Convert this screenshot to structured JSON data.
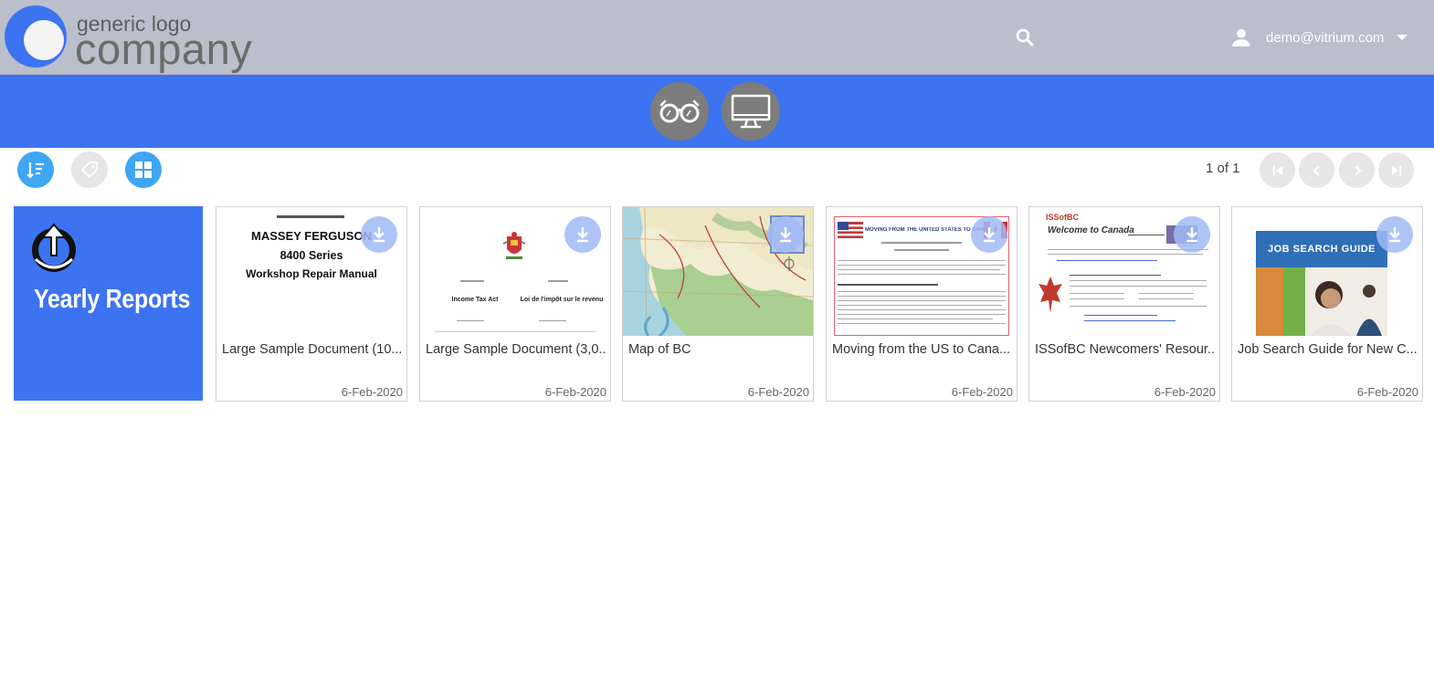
{
  "header": {
    "logo_small": "generic logo",
    "logo_big": "company",
    "user_email": "demo@vitrium.com",
    "icons": {
      "search": "search-icon",
      "user": "person-icon",
      "menu": "caret-down-icon"
    }
  },
  "band": {
    "buttons": [
      {
        "name": "reader-view",
        "icon": "glasses-icon"
      },
      {
        "name": "screen-view",
        "icon": "monitor-icon"
      }
    ]
  },
  "toolbar": {
    "buttons": [
      {
        "name": "sort",
        "icon": "sort-icon",
        "state": "active"
      },
      {
        "name": "tags",
        "icon": "tag-icon",
        "state": "disabled"
      },
      {
        "name": "grid-view",
        "icon": "grid-icon",
        "state": "active"
      }
    ],
    "page_info": "1 of 1",
    "pager": [
      "first-page-icon",
      "previous-page-icon",
      "next-page-icon",
      "last-page-icon"
    ]
  },
  "folder": {
    "title": "Yearly Reports",
    "color": "#3c73f0"
  },
  "documents": [
    {
      "title": "Large Sample Document (10...",
      "date": "6-Feb-2020",
      "thumb_title": "MASSEY FERGUSON",
      "thumb_sub1": "8400 Series",
      "thumb_sub2": "Workshop Repair Manual"
    },
    {
      "title": "Large Sample Document (3,0...",
      "date": "6-Feb-2020",
      "thumb_left": "Income Tax Act",
      "thumb_right": "Loi de l'impôt sur le revenu"
    },
    {
      "title": "Map of BC",
      "date": "6-Feb-2020"
    },
    {
      "title": "Moving from the US to Cana...",
      "date": "6-Feb-2020",
      "thumb_header": "MOVING FROM THE UNITED STATES TO CANADA"
    },
    {
      "title": "ISSofBC Newcomers' Resour...",
      "date": "6-Feb-2020",
      "thumb_header": "Welcome to Canada",
      "thumb_logo": "ISSofBC"
    },
    {
      "title": "Job Search Guide for New C...",
      "date": "6-Feb-2020",
      "thumb_header": "JOB SEARCH GUIDE"
    }
  ],
  "colors": {
    "accent": "#3c73f0",
    "toolbar_blue": "#3ea6f3",
    "header_bg": "#babfcb"
  }
}
